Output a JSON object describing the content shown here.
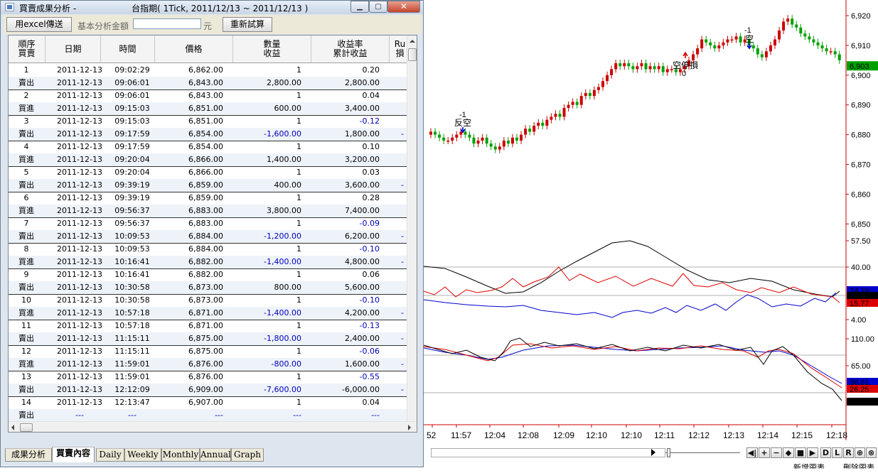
{
  "window": {
    "title": "買賣成果分析 -",
    "title_suffix": "台指期( 1Tick, 2011/12/13 ~ 2011/12/13 )",
    "min_glyph": "▁",
    "max_glyph": "▢",
    "close_glyph": "✕"
  },
  "toolbar": {
    "excel_label": "用excel傳送",
    "amount_label": "基本分析金額",
    "amount_value": "",
    "amount_unit": "元",
    "retest_label": "重新試算"
  },
  "table": {
    "headers": [
      {
        "line1": "順序",
        "line2": "買賣"
      },
      {
        "line1": "日期",
        "line2": ""
      },
      {
        "line1": "時間",
        "line2": ""
      },
      {
        "line1": "價格",
        "line2": ""
      },
      {
        "line1": "數量",
        "line2": "收益"
      },
      {
        "line1": "收益率",
        "line2": "累計收益"
      },
      {
        "line1": "Ru",
        "line2": "損"
      }
    ],
    "trades": [
      {
        "seq": "1",
        "side": "賣出",
        "d1": "2011-12-13",
        "t1": "09:02:29",
        "p1": "6,862.00",
        "qty": "1",
        "rate": "0.20",
        "d2": "2011-12-13",
        "t2": "09:06:01",
        "p2": "6,843.00",
        "profit": "2,800.00",
        "cum": "2,800.00",
        "rate_neg": false,
        "profit_neg": false,
        "ru": ""
      },
      {
        "seq": "2",
        "side": "買進",
        "d1": "2011-12-13",
        "t1": "09:06:01",
        "p1": "6,843.00",
        "qty": "1",
        "rate": "0.04",
        "d2": "2011-12-13",
        "t2": "09:15:03",
        "p2": "6,851.00",
        "profit": "600.00",
        "cum": "3,400.00",
        "rate_neg": false,
        "profit_neg": false,
        "ru": ""
      },
      {
        "seq": "3",
        "side": "賣出",
        "d1": "2011-12-13",
        "t1": "09:15:03",
        "p1": "6,851.00",
        "qty": "1",
        "rate": "-0.12",
        "d2": "2011-12-13",
        "t2": "09:17:59",
        "p2": "6,854.00",
        "profit": "-1,600.00",
        "cum": "1,800.00",
        "rate_neg": true,
        "profit_neg": true,
        "ru": "-"
      },
      {
        "seq": "4",
        "side": "買進",
        "d1": "2011-12-13",
        "t1": "09:17:59",
        "p1": "6,854.00",
        "qty": "1",
        "rate": "0.10",
        "d2": "2011-12-13",
        "t2": "09:20:04",
        "p2": "6,866.00",
        "profit": "1,400.00",
        "cum": "3,200.00",
        "rate_neg": false,
        "profit_neg": false,
        "ru": ""
      },
      {
        "seq": "5",
        "side": "賣出",
        "d1": "2011-12-13",
        "t1": "09:20:04",
        "p1": "6,866.00",
        "qty": "1",
        "rate": "0.03",
        "d2": "2011-12-13",
        "t2": "09:39:19",
        "p2": "6,859.00",
        "profit": "400.00",
        "cum": "3,600.00",
        "rate_neg": false,
        "profit_neg": false,
        "ru": "-"
      },
      {
        "seq": "6",
        "side": "買進",
        "d1": "2011-12-13",
        "t1": "09:39:19",
        "p1": "6,859.00",
        "qty": "1",
        "rate": "0.28",
        "d2": "2011-12-13",
        "t2": "09:56:37",
        "p2": "6,883.00",
        "profit": "3,800.00",
        "cum": "7,400.00",
        "rate_neg": false,
        "profit_neg": false,
        "ru": ""
      },
      {
        "seq": "7",
        "side": "賣出",
        "d1": "2011-12-13",
        "t1": "09:56:37",
        "p1": "6,883.00",
        "qty": "1",
        "rate": "-0.09",
        "d2": "2011-12-13",
        "t2": "10:09:53",
        "p2": "6,884.00",
        "profit": "-1,200.00",
        "cum": "6,200.00",
        "rate_neg": true,
        "profit_neg": true,
        "ru": "-"
      },
      {
        "seq": "8",
        "side": "買進",
        "d1": "2011-12-13",
        "t1": "10:09:53",
        "p1": "6,884.00",
        "qty": "1",
        "rate": "-0.10",
        "d2": "2011-12-13",
        "t2": "10:16:41",
        "p2": "6,882.00",
        "profit": "-1,400.00",
        "cum": "4,800.00",
        "rate_neg": true,
        "profit_neg": true,
        "ru": "-"
      },
      {
        "seq": "9",
        "side": "賣出",
        "d1": "2011-12-13",
        "t1": "10:16:41",
        "p1": "6,882.00",
        "qty": "1",
        "rate": "0.06",
        "d2": "2011-12-13",
        "t2": "10:30:58",
        "p2": "6,873.00",
        "profit": "800.00",
        "cum": "5,600.00",
        "rate_neg": false,
        "profit_neg": false,
        "ru": ""
      },
      {
        "seq": "10",
        "side": "買進",
        "d1": "2011-12-13",
        "t1": "10:30:58",
        "p1": "6,873.00",
        "qty": "1",
        "rate": "-0.10",
        "d2": "2011-12-13",
        "t2": "10:57:18",
        "p2": "6,871.00",
        "profit": "-1,400.00",
        "cum": "4,200.00",
        "rate_neg": true,
        "profit_neg": true,
        "ru": "-"
      },
      {
        "seq": "11",
        "side": "賣出",
        "d1": "2011-12-13",
        "t1": "10:57:18",
        "p1": "6,871.00",
        "qty": "1",
        "rate": "-0.13",
        "d2": "2011-12-13",
        "t2": "11:15:11",
        "p2": "6,875.00",
        "profit": "-1,800.00",
        "cum": "2,400.00",
        "rate_neg": true,
        "profit_neg": true,
        "ru": "-"
      },
      {
        "seq": "12",
        "side": "買進",
        "d1": "2011-12-13",
        "t1": "11:15:11",
        "p1": "6,875.00",
        "qty": "1",
        "rate": "-0.06",
        "d2": "2011-12-13",
        "t2": "11:59:01",
        "p2": "6,876.00",
        "profit": "-800.00",
        "cum": "1,600.00",
        "rate_neg": true,
        "profit_neg": true,
        "ru": "-"
      },
      {
        "seq": "13",
        "side": "賣出",
        "d1": "2011-12-13",
        "t1": "11:59:01",
        "p1": "6,876.00",
        "qty": "1",
        "rate": "-0.55",
        "d2": "2011-12-13",
        "t2": "12:12:09",
        "p2": "6,909.00",
        "profit": "-7,600.00",
        "cum": "-6,000.00",
        "rate_neg": true,
        "profit_neg": true,
        "ru": "-"
      },
      {
        "seq": "14",
        "side": "賣出",
        "d1": "2011-12-13",
        "t1": "12:13:47",
        "p1": "6,907.00",
        "qty": "1",
        "rate": "0.04",
        "d2": "---",
        "t2": "---",
        "p2": "---",
        "profit": "---",
        "cum": "---",
        "rate_neg": false,
        "profit_neg": false,
        "ru": "",
        "open": true
      }
    ]
  },
  "tabs": [
    {
      "label": "成果分析",
      "active": false
    },
    {
      "label": "買賣內容",
      "active": true
    },
    {
      "label": "Daily",
      "active": false
    },
    {
      "label": "Weekly",
      "active": false
    },
    {
      "label": "Monthly",
      "active": false
    },
    {
      "label": "Annual",
      "active": false
    },
    {
      "label": "Graph",
      "active": false
    }
  ],
  "chart": {
    "price_ticks": [
      "6,920",
      "6,910",
      "6,900",
      "6,890",
      "6,880",
      "6,870",
      "6,860",
      "6,850"
    ],
    "ind1_ticks": [
      "57.50",
      "40.00",
      "4.00"
    ],
    "ind2_ticks": [
      "110.00",
      "65.00",
      "20.00"
    ],
    "last_price": "6,903",
    "ind1_values": [
      "24.19",
      "20.32",
      "15.77"
    ],
    "ind2_values": [
      "36.61",
      "26.25",
      "5.54"
    ],
    "time_labels": [
      "52",
      "11:57",
      "12:04",
      "12:08",
      "12:09",
      "12:10",
      "12:10",
      "12:11",
      "12:12",
      "12:13",
      "12:14",
      "12:15",
      "12:18"
    ],
    "signals": [
      {
        "top": "-1",
        "label": "反空"
      },
      {
        "label": "空停損",
        "bottom": "0"
      },
      {
        "top": "-1",
        "label": "空"
      }
    ],
    "colors": {
      "up": "#cc0000",
      "down": "#00a000",
      "axis": "#cc0000",
      "ind_black": "#000000",
      "ind_red": "#dd0000",
      "ind_blue": "#0000cc"
    }
  },
  "nav": {
    "buttons": [
      "◀|",
      "+",
      "−",
      "◆",
      "■",
      "▶",
      "D",
      "L",
      "R",
      "⊕",
      "⊗"
    ],
    "bottom_left": "新增圖表",
    "bottom_right": "刪除圖表"
  }
}
